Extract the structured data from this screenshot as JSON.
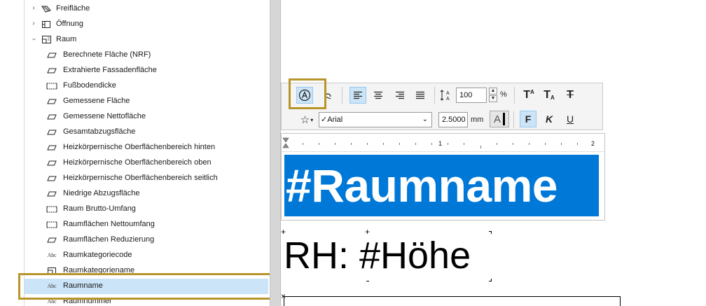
{
  "tree": {
    "parents": [
      {
        "label": "Freifläche",
        "icon": "freeform-surface-icon",
        "expanded": false
      },
      {
        "label": "Öffnung",
        "icon": "opening-icon",
        "expanded": false
      },
      {
        "label": "Raum",
        "icon": "room-icon",
        "expanded": true
      }
    ],
    "children": [
      {
        "label": "Berechnete Fläche (NRF)",
        "icon": "area-icon"
      },
      {
        "label": "Extrahierte Fassadenfläche",
        "icon": "area-icon"
      },
      {
        "label": "Fußbodendicke",
        "icon": "dimension-icon"
      },
      {
        "label": "Gemessene Fläche",
        "icon": "area-icon"
      },
      {
        "label": "Gemessene Nettofläche",
        "icon": "area-icon"
      },
      {
        "label": "Gesamtabzugsfläche",
        "icon": "area-icon"
      },
      {
        "label": "Heizkörpernische Oberflächenbereich hinten",
        "icon": "area-icon"
      },
      {
        "label": "Heizkörpernische Oberflächenbereich oben",
        "icon": "area-icon"
      },
      {
        "label": "Heizkörpernische Oberflächenbereich seitlich",
        "icon": "area-icon"
      },
      {
        "label": "Niedrige Abzugsfläche",
        "icon": "area-icon"
      },
      {
        "label": "Raum Brutto-Umfang",
        "icon": "dimension-icon"
      },
      {
        "label": "Raumflächen Nettoumfang",
        "icon": "dimension-icon"
      },
      {
        "label": "Raumflächen Reduzierung",
        "icon": "area-icon"
      },
      {
        "label": "Raumkategoriecode",
        "icon": "text-icon",
        "icon_text": "Abc"
      },
      {
        "label": "Raumkategoriename",
        "icon": "category-icon"
      },
      {
        "label": "Raumname",
        "icon": "text-icon",
        "icon_text": "Abc",
        "selected": true
      },
      {
        "label": "Raumnummer",
        "icon": "text-icon",
        "icon_text": "Abc"
      }
    ]
  },
  "toolbar": {
    "size_value": "100",
    "size_unit": "%",
    "font_name": "Arial",
    "font_size": "2.5000",
    "font_unit": "mm",
    "color_letter": "A",
    "bold_label": "F",
    "italic_label": "K",
    "underline_label": "U",
    "superscript_label": "T",
    "superscript_sup": "A",
    "subscript_label": "T",
    "subscript_sub": "A",
    "strike_label": "T"
  },
  "ruler": {
    "mark1": "1",
    "mark2": "2"
  },
  "editor": {
    "name_text": "#Raumname",
    "height_text": "RH: #Höhe"
  },
  "colors": {
    "highlight_box": "#b8952a",
    "selection_fill": "#0078d7",
    "tree_selection": "#cce4f7"
  }
}
